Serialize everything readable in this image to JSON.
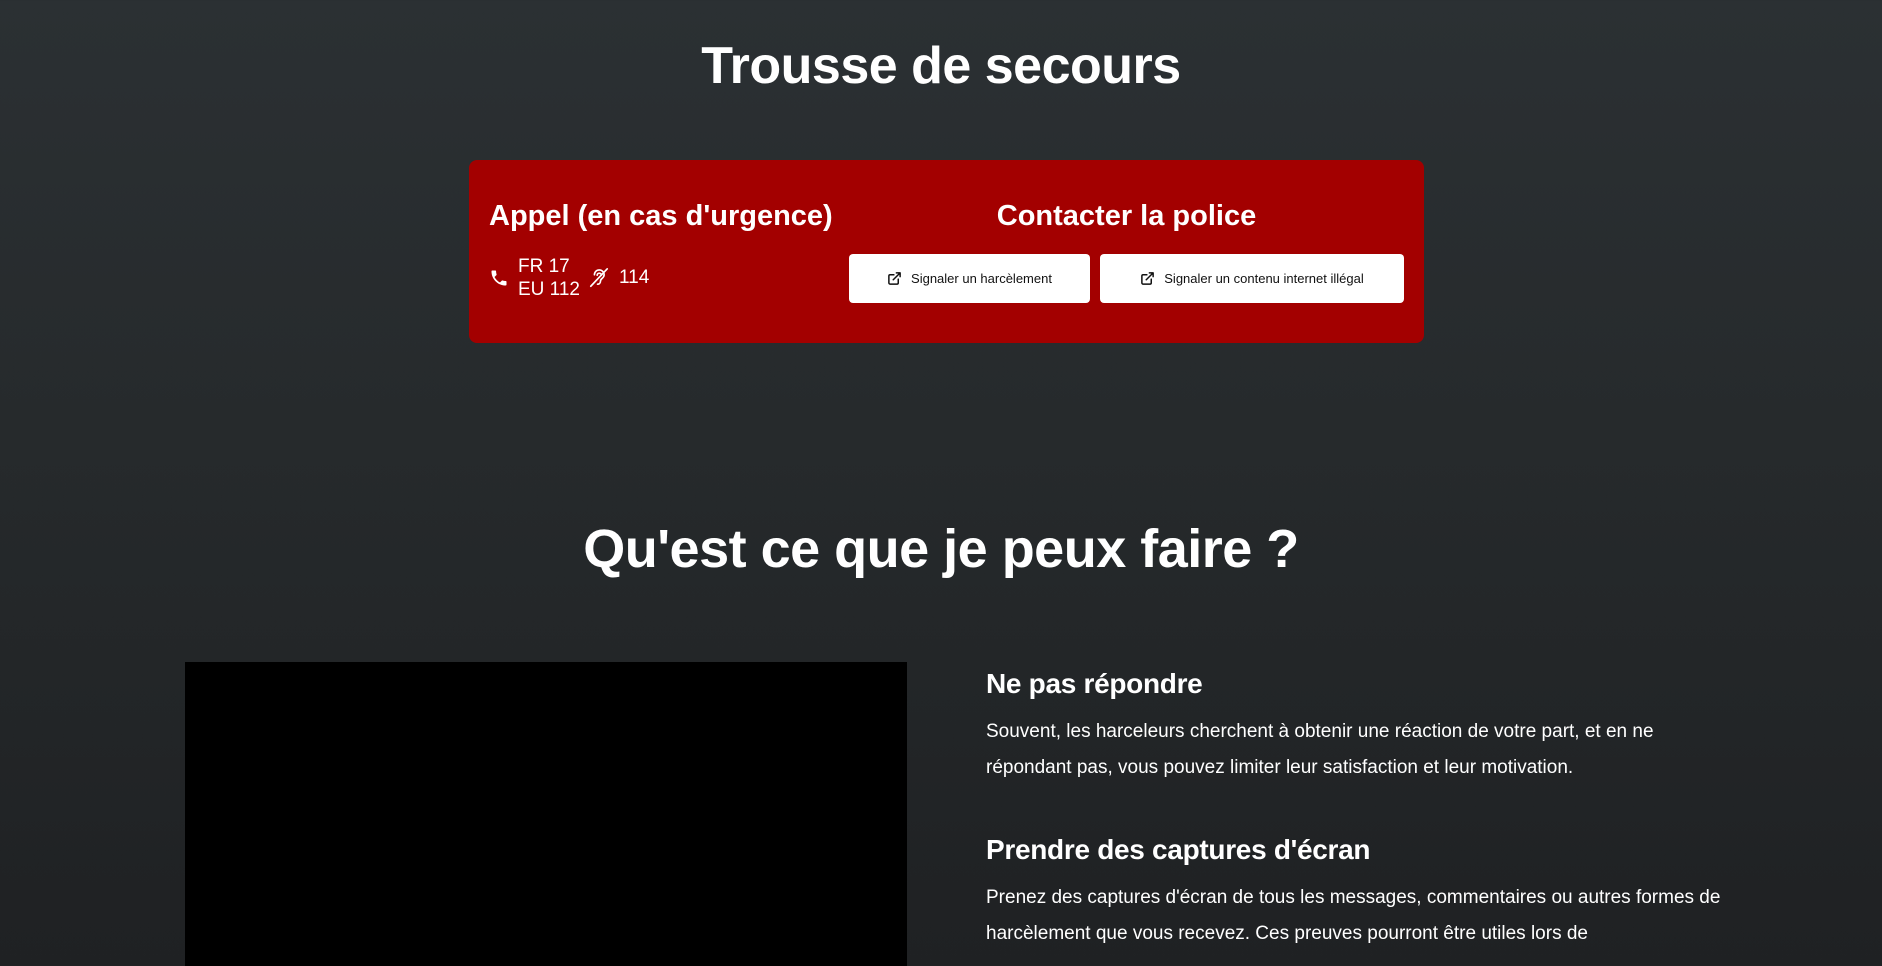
{
  "page": {
    "title": "Trousse de secours"
  },
  "emergency": {
    "call_heading": "Appel (en cas d'urgence)",
    "numbers": {
      "fr": "FR 17",
      "eu": "EU 112",
      "deaf": "114"
    },
    "icons": [
      "phone-icon",
      "deaf-icon",
      "external-link-icon"
    ],
    "background_color": "#a30000",
    "police_heading": "Contacter la police",
    "buttons": {
      "harassment": "Signaler un harcèlement",
      "illegal_content": "Signaler un contenu internet illégal"
    }
  },
  "section": {
    "title": "Qu'est ce que je peux faire ?",
    "tips": [
      {
        "title": "Ne pas répondre",
        "text": "Souvent, les harceleurs cherchent à obtenir une réaction de votre part, et en ne répondant pas, vous pouvez limiter leur satisfaction et leur motivation."
      },
      {
        "title": "Prendre des captures d'écran",
        "text": "Prenez des captures d'écran de tous les messages, commentaires ou autres formes de harcèlement que vous recevez. Ces preuves pourront être utiles lors de"
      }
    ]
  }
}
